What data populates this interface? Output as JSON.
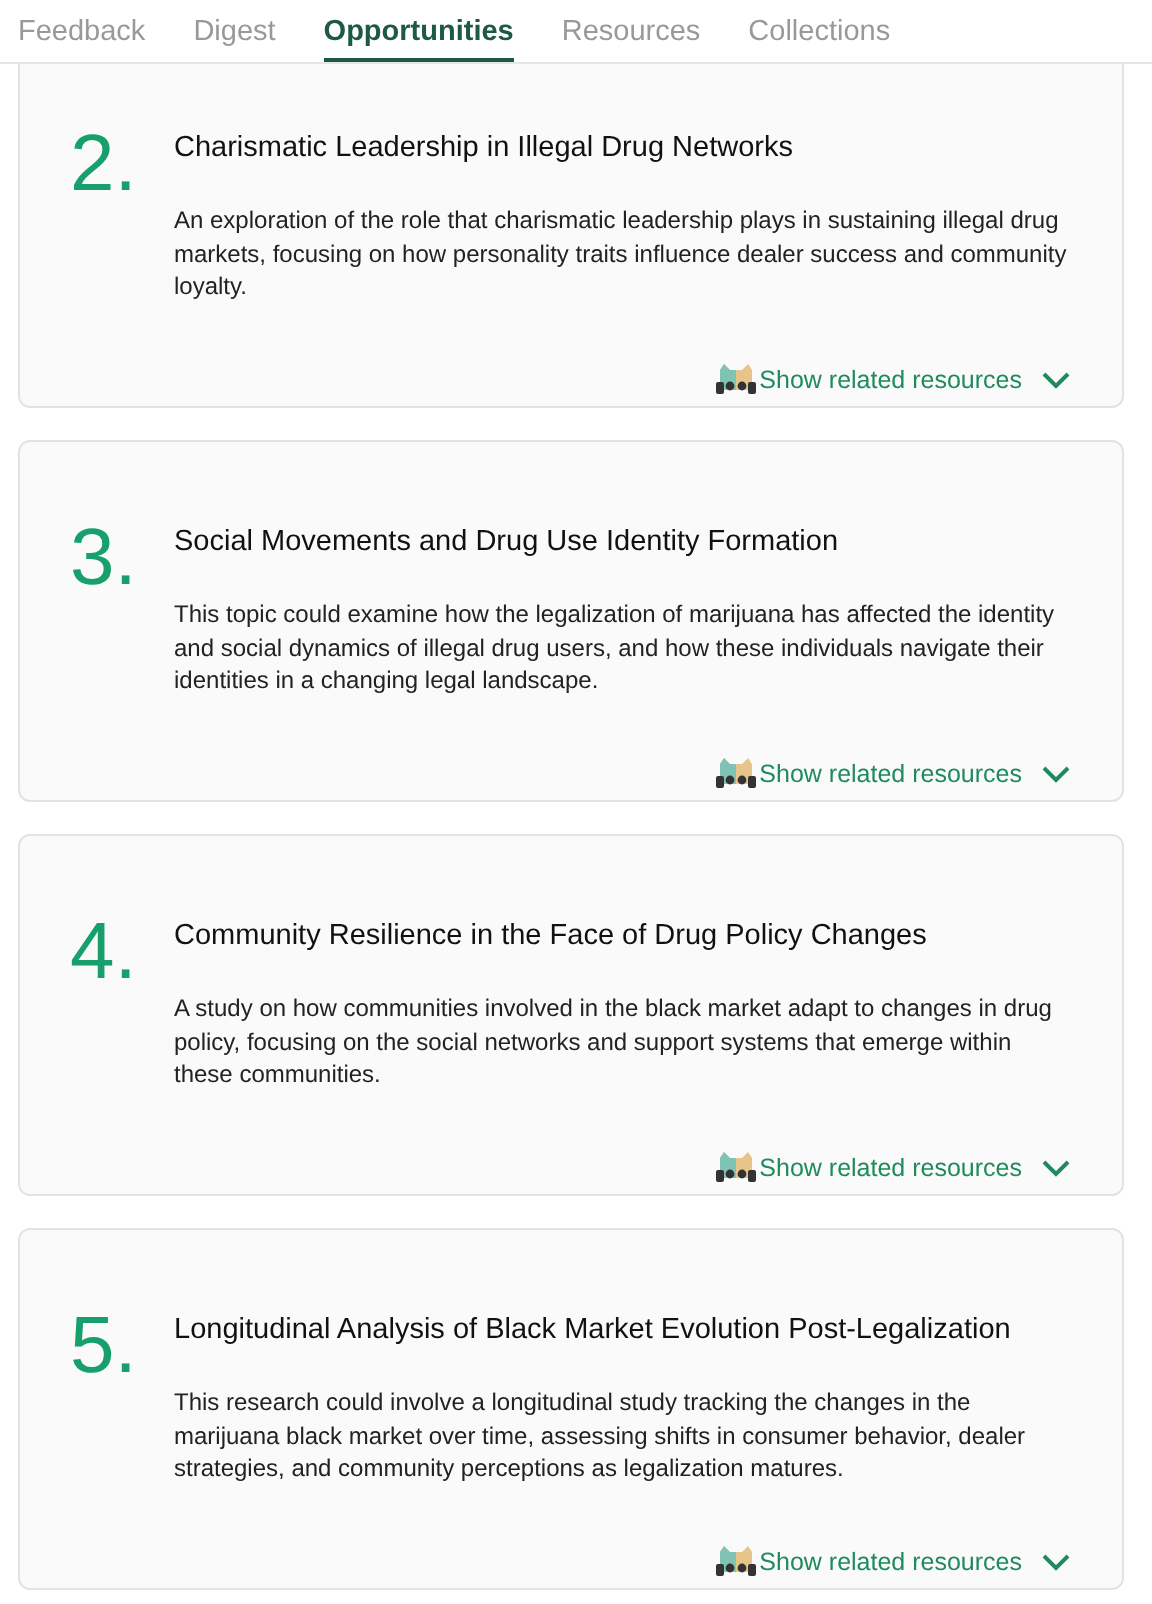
{
  "tabs": [
    {
      "label": "Feedback",
      "selected": false
    },
    {
      "label": "Digest",
      "selected": false
    },
    {
      "label": "Opportunities",
      "selected": true
    },
    {
      "label": "Resources",
      "selected": false
    },
    {
      "label": "Collections",
      "selected": false
    }
  ],
  "opportunities": [
    {
      "number": "2.",
      "title": "Charismatic Leadership in Illegal Drug Networks",
      "description": "An exploration of the role that charismatic leadership plays in sustaining illegal drug markets, focusing on how personality traits influence dealer success and community loyalty.",
      "link": "Show related resources",
      "expanded": false
    },
    {
      "number": "3.",
      "title": "Social Movements and Drug Use Identity Formation",
      "description": "This topic could examine how the legalization of marijuana has affected the identity and social dynamics of illegal drug users, and how these individuals navigate their identities in a changing legal landscape.",
      "link": "Show related resources",
      "expanded": false
    },
    {
      "number": "4.",
      "title": "Community Resilience in the Face of Drug Policy Changes",
      "description": "A study on how communities involved in the black market adapt to changes in drug policy, focusing on the social networks and support systems that emerge within these communities.",
      "link": "Show related resources",
      "expanded": false
    },
    {
      "number": "5.",
      "title": "Longitudinal Analysis of Black Market Evolution Post-Legalization",
      "description": "This research could involve a longitudinal study tracking the changes in the marijuana black market over time, assessing shifts in consumer behavior, dealer strategies, and community perceptions as legalization matures.",
      "link": "Show related resources",
      "expanded": false
    }
  ]
}
